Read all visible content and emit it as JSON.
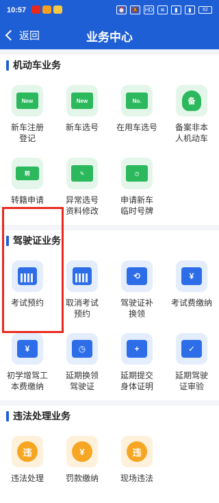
{
  "status_bar": {
    "time": "10:57",
    "battery": "62"
  },
  "nav": {
    "back_label": "返回",
    "title": "业务中心"
  },
  "sections": [
    {
      "title": "机动车业务",
      "items": [
        {
          "label": "新车注册\n登记",
          "card": "New"
        },
        {
          "label": "新车选号",
          "card": "New"
        },
        {
          "label": "在用车选号",
          "card": "No."
        },
        {
          "label": "备案非本\n人机动车",
          "card": "备"
        },
        {
          "label": "转籍申请",
          "card": "转"
        },
        {
          "label": "异常选号\n资料修改",
          "card": "✎"
        },
        {
          "label": "申请新车\n临时号牌",
          "card": "◷"
        }
      ]
    },
    {
      "title": "驾驶证业务",
      "items": [
        {
          "label": "考试预约"
        },
        {
          "label": "取消考试\n预约"
        },
        {
          "label": "驾驶证补\n换领",
          "card": "⟲"
        },
        {
          "label": "考试费缴纳",
          "card": "¥"
        },
        {
          "label": "初学增驾工\n本费缴纳",
          "card": "¥"
        },
        {
          "label": "延期换领\n驾驶证",
          "card": "◷"
        },
        {
          "label": "延期提交\n身体证明",
          "card": "+"
        },
        {
          "label": "延期驾驶\n证审验",
          "card": "✓"
        }
      ]
    },
    {
      "title": "违法处理业务",
      "items": [
        {
          "label": "违法处理",
          "card": "违"
        },
        {
          "label": "罚款缴纳",
          "card": "¥"
        },
        {
          "label": "现场违法",
          "card": "违"
        }
      ]
    }
  ],
  "colors": {
    "brand": "#1f5fd6",
    "green": "#2cb85c",
    "blue": "#2d6ee8",
    "orange": "#f6a623",
    "highlight": "#e8281c"
  }
}
